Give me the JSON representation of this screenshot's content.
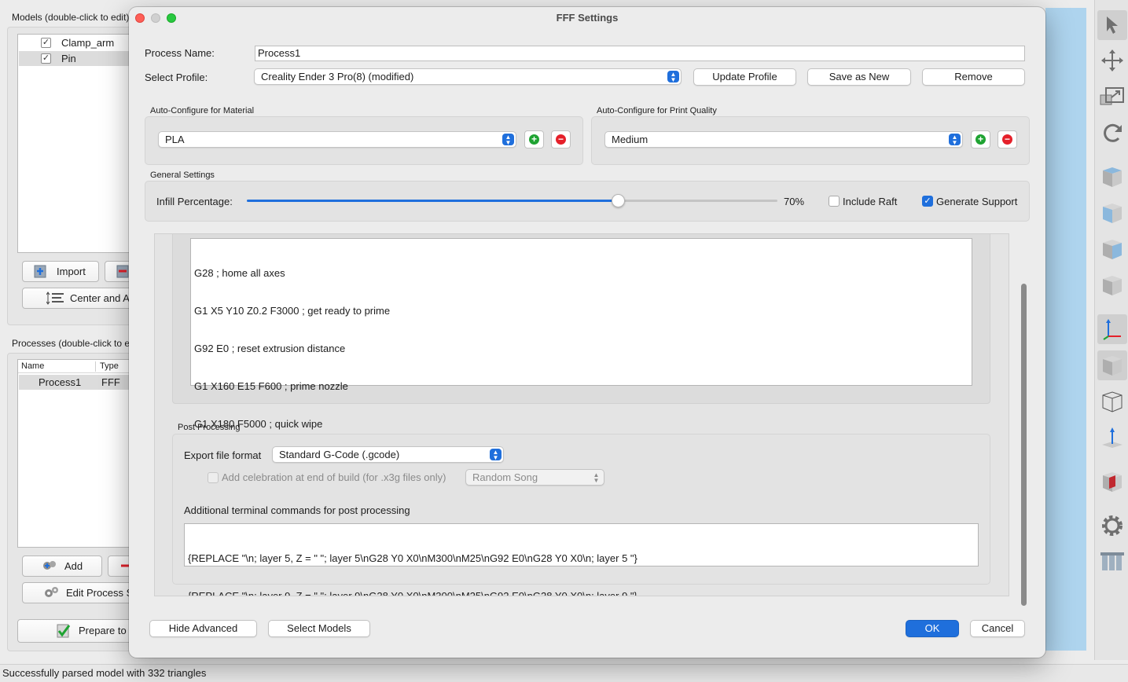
{
  "background": {
    "models_label": "Models (double-click to edit)",
    "models": [
      {
        "name": "Clamp_arm",
        "checked": true
      },
      {
        "name": "Pin",
        "checked": true
      }
    ],
    "import_label": "Import",
    "center_label": "Center and A",
    "processes_label": "Processes (double-click to e",
    "process_columns": [
      "Name",
      "Type"
    ],
    "processes": [
      {
        "name": "Process1",
        "type": "FFF"
      }
    ],
    "add_label": "Add",
    "edit_process_label": "Edit Process S",
    "prepare_label": "Prepare to",
    "status": "Successfully parsed model with 332 triangles"
  },
  "dialog": {
    "title": "FFF Settings",
    "process_name_label": "Process Name:",
    "process_name_value": "Process1",
    "select_profile_label": "Select Profile:",
    "profile_value": "Creality Ender 3 Pro(8) (modified)",
    "update_profile": "Update Profile",
    "save_as_new": "Save as New",
    "remove": "Remove",
    "material_group": "Auto-Configure for Material",
    "material_value": "PLA",
    "quality_group": "Auto-Configure for Print Quality",
    "quality_value": "Medium",
    "general_group": "General Settings",
    "infill_label": "Infill Percentage:",
    "infill_percent": 70,
    "infill_text": "70%",
    "include_raft_label": "Include Raft",
    "include_raft": false,
    "generate_support_label": "Generate Support",
    "generate_support": true,
    "gcode_lines": [
      "G28 ; home all axes",
      "G1 X5 Y10 Z0.2 F3000 ; get ready to prime",
      "G92 E0 ; reset extrusion distance",
      "G1 X160 E15 F600 ; prime nozzle",
      "G1 X180 F5000 ; quick wipe"
    ],
    "post_processing_group": "Post Processing",
    "export_format_label": "Export file format",
    "export_format_value": "Standard G-Code (.gcode)",
    "celebration_label": "Add celebration at end of build (for .x3g files only)",
    "celebration_value": "Random Song",
    "additional_commands_label": "Additional terminal commands for post processing",
    "additional_commands": [
      "{REPLACE \"\\n; layer 5, Z = \" \"; layer 5\\nG28 Y0 X0\\nM300\\nM25\\nG92 E0\\nG28 Y0 X0\\n; layer 5 \"}",
      "{REPLACE \"\\n; layer 9, Z = \" \"; layer 9\\nG28 Y0 X0\\nM300\\nM25\\nG92 E0\\nG28 Y0 X0\\n; layer 9 \"}"
    ],
    "hide_advanced": "Hide Advanced",
    "select_models": "Select Models",
    "ok": "OK",
    "cancel": "Cancel"
  },
  "colors": {
    "accent": "#1f6fdc",
    "viewport": "#aed4ee",
    "add_green": "#1fa332",
    "remove_red": "#e5202a"
  }
}
